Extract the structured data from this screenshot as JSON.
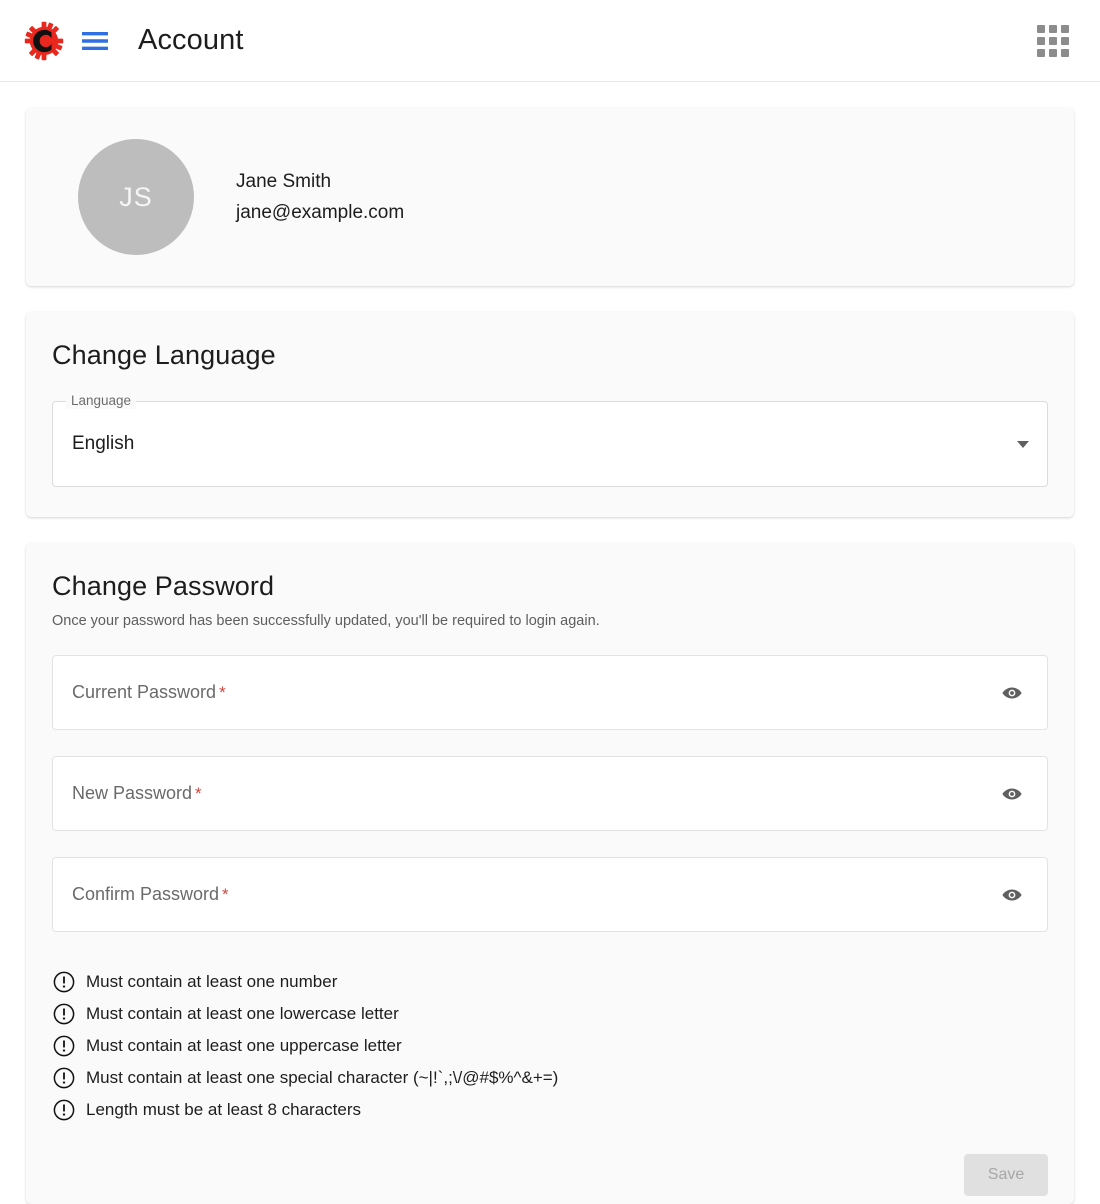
{
  "header": {
    "logo_icon": "gear-c-logo",
    "logo_letter": "C",
    "menu_icon": "hamburger-menu-icon",
    "title": "Account",
    "apps_icon": "apps-grid-icon",
    "accent_blue": "#2f6fe4",
    "logo_red": "#e8281e"
  },
  "profile": {
    "avatar_initials": "JS",
    "avatar_color": "#bdbdbd",
    "name": "Jane Smith",
    "email": "jane@example.com"
  },
  "language": {
    "title": "Change Language",
    "field_legend": "Language",
    "selected": "English",
    "dropdown_icon": "chevron-down-icon"
  },
  "password": {
    "title": "Change Password",
    "subtitle": "Once your password has been successfully updated, you'll be required to login again.",
    "fields": [
      {
        "label": "Current Password",
        "required_marker": "*",
        "value": "",
        "toggle_icon": "eye-icon"
      },
      {
        "label": "New Password",
        "required_marker": "*",
        "value": "",
        "toggle_icon": "eye-icon"
      },
      {
        "label": "Confirm Password",
        "required_marker": "*",
        "value": "",
        "toggle_icon": "eye-icon"
      }
    ],
    "requirements_icon": "exclamation-circle-icon",
    "requirements": [
      "Must contain at least one number",
      "Must contain at least one lowercase letter",
      "Must contain at least one uppercase letter",
      "Must contain at least one special character (~|!`,;\\/@#$%^&+=)",
      "Length must be at least 8 characters"
    ],
    "save_label": "Save",
    "save_disabled": true,
    "required_color": "#d0473e"
  }
}
